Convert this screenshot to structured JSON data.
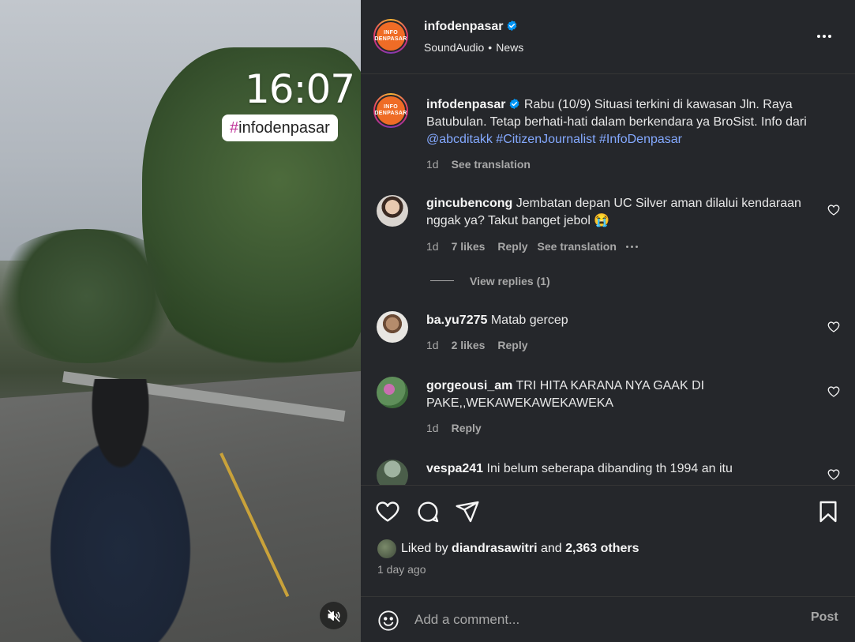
{
  "media": {
    "time_overlay": "16:07",
    "hashtag_overlay_hash": "#",
    "hashtag_overlay_text": "infodenpasar",
    "mute_icon": "speaker-muted-icon"
  },
  "header": {
    "username": "infodenpasar",
    "verified_icon": "verified-badge-icon",
    "audio": "SoundAudio",
    "separator": "•",
    "category": "News",
    "more_icon": "more-horizontal-icon",
    "avatar_line1": "INFO",
    "avatar_line2": "DENPASAR"
  },
  "caption": {
    "username": "infodenpasar",
    "text": "Rabu (10/9) Situasi terkini di kawasan Jln. Raya Batubulan. Tetap berhati-hati dalam berkendara ya BroSist. Info dari ",
    "mention": "@abcditakk",
    "tag1": "#CitizenJournalist",
    "tag2": "#InfoDenpasar",
    "time": "1d",
    "see_translation": "See translation"
  },
  "comments": [
    {
      "username": "gincubencong",
      "text": "Jembatan depan UC Silver aman dilalui kendaraan nggak ya? Takut banget jebol 😭",
      "time": "1d",
      "likes": "7 likes",
      "reply": "Reply",
      "see_translation": "See translation",
      "view_replies": "View replies (1)"
    },
    {
      "username": "ba.yu7275",
      "text": "Matab gercep",
      "time": "1d",
      "likes": "2 likes",
      "reply": "Reply"
    },
    {
      "username": "gorgeousi_am",
      "text": "TRI HITA KARANA NYA GAAK DI PAKE,,WEKAWEKAWEKAWEKA",
      "time": "1d",
      "reply": "Reply"
    },
    {
      "username": "vespa241",
      "text": "Ini belum seberapa dibanding th 1994 an itu"
    }
  ],
  "actions": {
    "like_icon": "heart-icon",
    "comment_icon": "comment-icon",
    "share_icon": "share-icon",
    "save_icon": "bookmark-icon",
    "liked_by_prefix": "Liked by ",
    "liked_by_user": "diandrasawitri",
    "liked_by_and": " and ",
    "liked_by_others": "2,363 others",
    "time_ago": "1 day ago"
  },
  "add_comment": {
    "emoji_icon": "emoji-icon",
    "placeholder": "Add a comment...",
    "post_label": "Post"
  },
  "colors": {
    "panel_bg": "#25272b",
    "link": "#84a9ff",
    "muted": "#a8a8a8",
    "verified": "#0095f6"
  }
}
